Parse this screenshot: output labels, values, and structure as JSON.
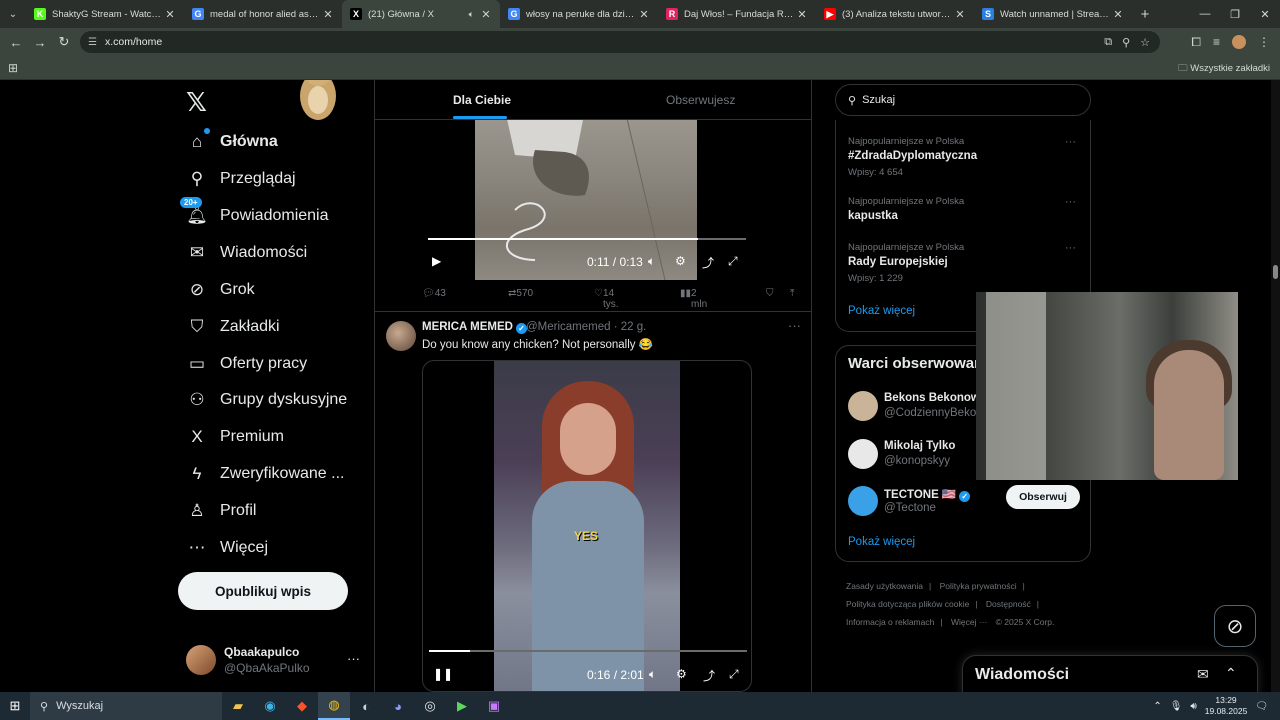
{
  "browser": {
    "tabs": [
      {
        "title": "ShaktyG Stream - Watch Live on",
        "fav_color": "#53fc18",
        "fav": "K",
        "active": false
      },
      {
        "title": "medal of honor alied assault] -",
        "fav_color": "#4285f4",
        "fav": "G",
        "active": false
      },
      {
        "title": "(21) Główna / X",
        "fav_color": "#000000",
        "fav": "X",
        "active": true
      },
      {
        "title": "włosy na peruke dla dzieci chor",
        "fav_color": "#4285f4",
        "fav": "G",
        "active": false
      },
      {
        "title": "Daj Włos! – Fundacja Rak'n'Roll",
        "fav_color": "#e0245e",
        "fav": "R",
        "active": false
      },
      {
        "title": "(3) Analiza tekstu utworu SB Ma",
        "fav_color": "#ff0000",
        "fav": "▶",
        "active": false
      },
      {
        "title": "Watch unnamed | Streamable",
        "fav_color": "#2b7fe0",
        "fav": "S",
        "active": false
      }
    ],
    "url": "x.com/home",
    "bookmarks_all": "Wszystkie zakładki"
  },
  "nav": {
    "items": [
      {
        "label": "Główna",
        "icon": "home-icon",
        "glyph": "⌂",
        "bold": true
      },
      {
        "label": "Przeglądaj",
        "icon": "search-icon",
        "glyph": "⚲"
      },
      {
        "label": "Powiadomienia",
        "icon": "bell-icon",
        "glyph": "🔔︎",
        "badge": "20+"
      },
      {
        "label": "Wiadomości",
        "icon": "envelope-icon",
        "glyph": "✉"
      },
      {
        "label": "Grok",
        "icon": "grok-icon",
        "glyph": "⊘"
      },
      {
        "label": "Zakładki",
        "icon": "bookmark-icon",
        "glyph": "⛉"
      },
      {
        "label": "Oferty pracy",
        "icon": "briefcase-icon",
        "glyph": "▭"
      },
      {
        "label": "Grupy dyskusyjne",
        "icon": "communities-icon",
        "glyph": "⚇"
      },
      {
        "label": "Premium",
        "icon": "x-premium-icon",
        "glyph": "X"
      },
      {
        "label": "Zweryfikowane ...",
        "icon": "lightning-icon",
        "glyph": "ϟ"
      },
      {
        "label": "Profil",
        "icon": "person-icon",
        "glyph": "♙"
      },
      {
        "label": "Więcej",
        "icon": "more-circle-icon",
        "glyph": "⋯"
      }
    ],
    "post_button": "Opublikuj wpis",
    "account": {
      "name": "Qbaakapulco",
      "handle": "@QbaAkaPulko"
    }
  },
  "timeline": {
    "tabs": [
      "Dla Ciebie",
      "Obserwujesz"
    ],
    "tweet1": {
      "video_time": "0:11 / 0:13",
      "progress": 0.85,
      "replies": "43",
      "retweets": "570",
      "likes": "14 tys.",
      "views": "2 mln"
    },
    "tweet2": {
      "name": "MERICA MEMED",
      "handle": "@Mericamemed · 22 g.",
      "text": "Do you know any chicken? Not personally 😂",
      "video_caption": "YES",
      "video_time": "0:16 / 2:01",
      "progress": 0.13
    }
  },
  "sidebar": {
    "search_placeholder": "Szukaj",
    "trends": [
      {
        "context": "Najpopularniejsze w Polska",
        "name": "#ZdradaDyplomatyczna",
        "count": "Wpisy: 4 654"
      },
      {
        "context": "Najpopularniejsze w Polska",
        "name": "kapustka",
        "count": ""
      },
      {
        "context": "Najpopularniejsze w Polska",
        "name": "Rady Europejskiej",
        "count": "Wpisy: 1 229"
      }
    ],
    "show_more": "Pokaż więcej",
    "who_title": "Warci obserwowania",
    "who": [
      {
        "name": "Bekons Bekonowy",
        "handle": "@CodziennyBekon"
      },
      {
        "name": "Mikolaj Tylko",
        "handle": "@konopskyy"
      },
      {
        "name": "TECTONE 🇺🇸",
        "handle": "@Tectone",
        "verified": true
      }
    ],
    "follow_button": "Obserwuj",
    "footer": [
      "Zasady użytkowania",
      "Polityka prywatności",
      "Polityka dotycząca plików cookie",
      "Dostępność",
      "Informacja o reklamach",
      "Więcej ···",
      "© 2025 X Corp."
    ]
  },
  "messages_drawer": "Wiadomości",
  "taskbar": {
    "search": "Wyszukaj",
    "time": "13:29",
    "date": "19.08.2025"
  }
}
